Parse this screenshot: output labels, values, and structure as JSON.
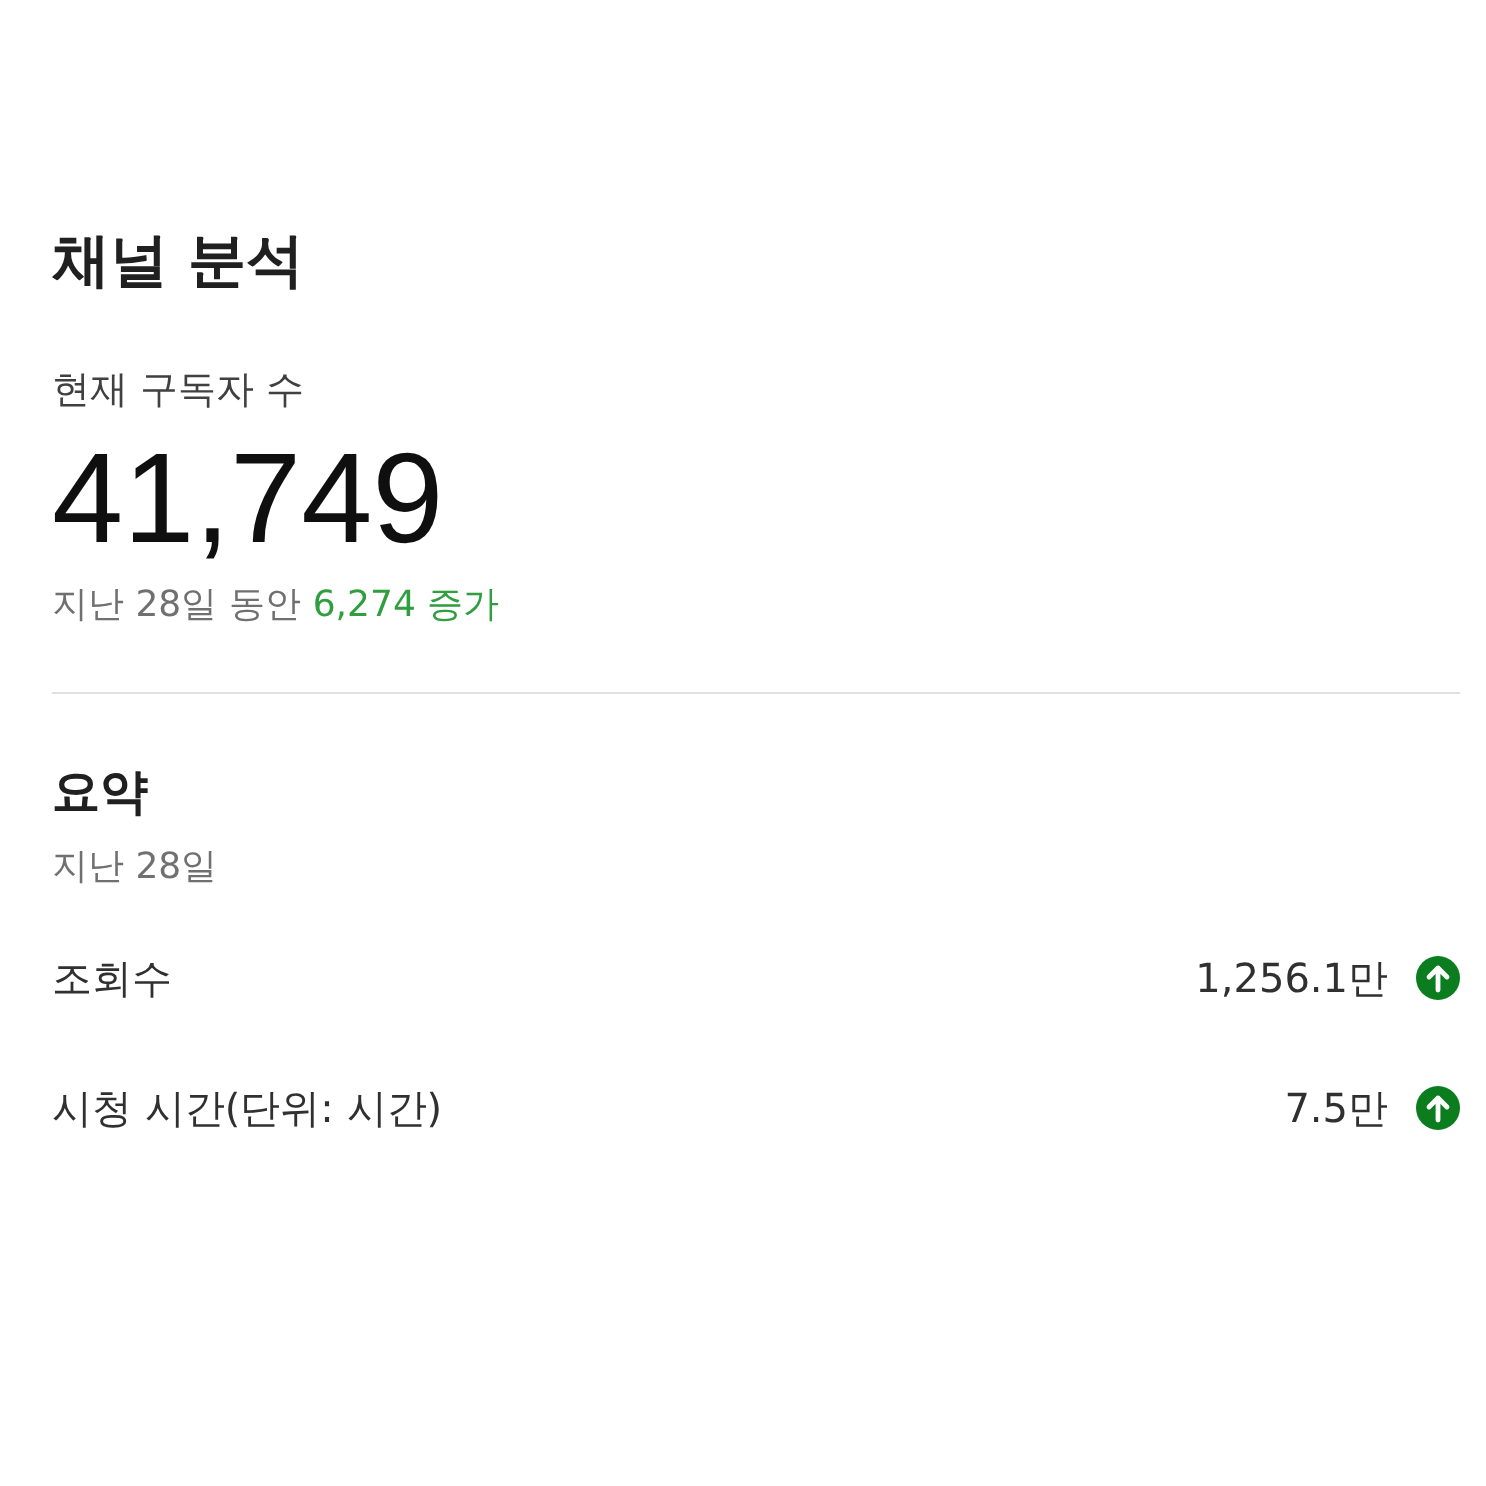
{
  "title": "채널 분석",
  "subscribers": {
    "label": "현재 구독자 수",
    "count": "41,749",
    "period": "지난 28일 동안",
    "change": "6,274 증가",
    "rising": true
  },
  "summary": {
    "title": "요약",
    "period": "지난 28일",
    "metrics": [
      {
        "label": "조회수",
        "value": "1,256.1만",
        "rising": true
      },
      {
        "label": "시청 시간(단위: 시간)",
        "value": "7.5만",
        "rising": true
      }
    ]
  }
}
